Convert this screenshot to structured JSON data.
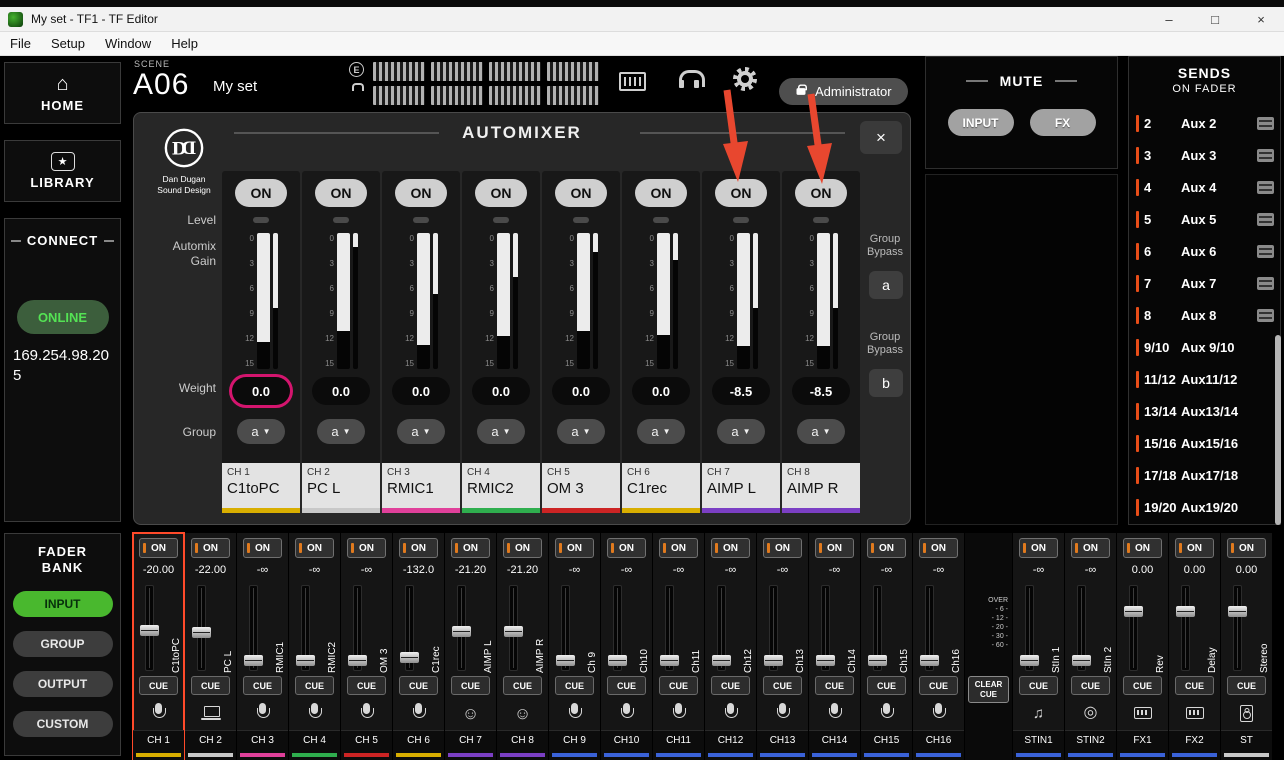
{
  "window": {
    "title": "My set - TF1 - TF Editor",
    "controls": {
      "minimize": "–",
      "maximize": "□",
      "close": "×"
    },
    "menu": [
      "File",
      "Setup",
      "Window",
      "Help"
    ]
  },
  "topbar": {
    "scene_label": "SCENE",
    "scene_id": "A06",
    "scene_name": "My set",
    "edit_badge": "E",
    "user": "Administrator"
  },
  "sidebar": {
    "home": "HOME",
    "home_glyph": "⌂",
    "library": "LIBRARY",
    "library_glyph": "★",
    "connect": "CONNECT",
    "online": "ONLINE",
    "ip": "169.254.98.205",
    "fader_bank": "FADER BANK",
    "banks": [
      {
        "label": "INPUT",
        "active": true
      },
      {
        "label": "GROUP"
      },
      {
        "label": "OUTPUT"
      },
      {
        "label": "CUSTOM"
      }
    ]
  },
  "mute": {
    "title": "MUTE",
    "input": "INPUT",
    "fx": "FX"
  },
  "sends": {
    "title": "SENDS",
    "subtitle": "ON FADER",
    "items": [
      {
        "num": "2",
        "label": "Aux 2",
        "has_icon": true
      },
      {
        "num": "3",
        "label": "Aux 3",
        "has_icon": true
      },
      {
        "num": "4",
        "label": "Aux 4",
        "has_icon": true
      },
      {
        "num": "5",
        "label": "Aux 5",
        "has_icon": true
      },
      {
        "num": "6",
        "label": "Aux 6",
        "has_icon": true
      },
      {
        "num": "7",
        "label": "Aux 7",
        "has_icon": true
      },
      {
        "num": "8",
        "label": "Aux 8",
        "has_icon": true
      },
      {
        "num": "9/10",
        "label": "Aux 9/10",
        "has_icon": false
      },
      {
        "num": "11/12",
        "label": "Aux11/12",
        "has_icon": false
      },
      {
        "num": "13/14",
        "label": "Aux13/14",
        "has_icon": false
      },
      {
        "num": "15/16",
        "label": "Aux15/16",
        "has_icon": false
      },
      {
        "num": "17/18",
        "label": "Aux17/18",
        "has_icon": false
      },
      {
        "num": "19/20",
        "label": "Aux19/20",
        "has_icon": false
      }
    ]
  },
  "automixer": {
    "title": "AUTOMIXER",
    "close": "×",
    "logo": {
      "line1": "Dan Dugan",
      "line2": "Sound Design"
    },
    "labels": {
      "level": "Level",
      "gain1": "Automix",
      "gain2": "Gain",
      "weight": "Weight",
      "group": "Group"
    },
    "on_label": "ON",
    "caret": "▼",
    "scale": [
      "0",
      "3",
      "6",
      "9",
      "12",
      "15"
    ],
    "bypass": {
      "label1": "Group",
      "label2": "Bypass",
      "a": "a",
      "b": "b"
    },
    "channels": [
      {
        "weight": "0.0",
        "group": "a",
        "ch": "CH 1",
        "name": "C1toPC",
        "color": "#d8ae00",
        "main": "80%",
        "side": "55%",
        "ring": "0 0 0 3px #d4156e"
      },
      {
        "weight": "0.0",
        "group": "a",
        "ch": "CH 2",
        "name": "PC L",
        "color": "#c8c8c8",
        "main": "72%",
        "side": "10%"
      },
      {
        "weight": "0.0",
        "group": "a",
        "ch": "CH 3",
        "name": "RMIC1",
        "color": "#e0409a",
        "main": "82%",
        "side": "45%"
      },
      {
        "weight": "0.0",
        "group": "a",
        "ch": "CH 4",
        "name": "RMIC2",
        "color": "#2fae4e",
        "main": "76%",
        "side": "32%"
      },
      {
        "weight": "0.0",
        "group": "a",
        "ch": "CH 5",
        "name": "OM 3",
        "color": "#cc2424",
        "main": "72%",
        "side": "14%"
      },
      {
        "weight": "0.0",
        "group": "a",
        "ch": "CH 6",
        "name": "C1rec",
        "color": "#d8ae00",
        "main": "75%",
        "side": "20%"
      },
      {
        "weight": "-8.5",
        "group": "a",
        "ch": "CH 7",
        "name": "AIMP L",
        "color": "#7b3fc4",
        "main": "83%",
        "side": "55%"
      },
      {
        "weight": "-8.5",
        "group": "a",
        "ch": "CH 8",
        "name": "AIMP R",
        "color": "#7b3fc4",
        "main": "83%",
        "side": "55%"
      }
    ]
  },
  "faders": {
    "on_label": "ON",
    "cue_label": "CUE",
    "bridge": {
      "labels": [
        "OVER",
        "- 6 -",
        "- 12 -",
        "- 20 -",
        "- 30 -",
        "- 60 -"
      ],
      "clear1": "CLEAR",
      "clear2": "CUE"
    },
    "strips": [
      {
        "value": "-20.00",
        "name": "C1toPC",
        "ch": "CH 1",
        "color": "#d8ae00",
        "icon": "mic",
        "fader": "52%",
        "outline": "2px solid #ff4a2a"
      },
      {
        "value": "-22.00",
        "name": "PC L",
        "ch": "CH 2",
        "color": "#c8c8c8",
        "icon": "laptop",
        "fader": "55%"
      },
      {
        "value": "-∞",
        "name": "RMIC1",
        "ch": "CH 3",
        "color": "#e0409a",
        "icon": "mic",
        "fader": "88%"
      },
      {
        "value": "-∞",
        "name": "RMIC2",
        "ch": "CH 4",
        "color": "#2fae4e",
        "icon": "mic",
        "fader": "88%"
      },
      {
        "value": "-∞",
        "name": "OM 3",
        "ch": "CH 5",
        "color": "#cc2424",
        "icon": "mic",
        "fader": "88%"
      },
      {
        "value": "-132.0",
        "name": "C1rec",
        "ch": "CH 6",
        "color": "#d8ae00",
        "icon": "mic",
        "fader": "85%"
      },
      {
        "value": "-21.20",
        "name": "AIMP L",
        "ch": "CH 7",
        "color": "#7b3fc4",
        "icon": "smiley",
        "fader": "53%"
      },
      {
        "value": "-21.20",
        "name": "AIMP R",
        "ch": "CH 8",
        "color": "#7b3fc4",
        "icon": "smiley",
        "fader": "53%"
      },
      {
        "value": "-∞",
        "name": "Ch 9",
        "ch": "CH 9",
        "color": "#3a62d8",
        "icon": "mic",
        "fader": "88%"
      },
      {
        "value": "-∞",
        "name": "Ch10",
        "ch": "CH10",
        "color": "#3a62d8",
        "icon": "mic",
        "fader": "88%"
      },
      {
        "value": "-∞",
        "name": "Ch11",
        "ch": "CH11",
        "color": "#3a62d8",
        "icon": "mic",
        "fader": "88%"
      },
      {
        "value": "-∞",
        "name": "Ch12",
        "ch": "CH12",
        "color": "#3a62d8",
        "icon": "mic",
        "fader": "88%"
      },
      {
        "value": "-∞",
        "name": "Ch13",
        "ch": "CH13",
        "color": "#3a62d8",
        "icon": "mic",
        "fader": "88%"
      },
      {
        "value": "-∞",
        "name": "Ch14",
        "ch": "CH14",
        "color": "#3a62d8",
        "icon": "mic",
        "fader": "88%"
      },
      {
        "value": "-∞",
        "name": "Ch15",
        "ch": "CH15",
        "color": "#3a62d8",
        "icon": "mic",
        "fader": "88%"
      },
      {
        "value": "-∞",
        "name": "Ch16",
        "ch": "CH16",
        "color": "#3a62d8",
        "icon": "mic",
        "fader": "88%"
      }
    ],
    "masters": [
      {
        "value": "-∞",
        "name": "StIn 1",
        "ch": "STIN1",
        "color": "#3a62d8",
        "icon": "music",
        "fader": "88%"
      },
      {
        "value": "-∞",
        "name": "StIn 2",
        "ch": "STIN2",
        "color": "#3a62d8",
        "icon": "disc",
        "fader": "88%"
      },
      {
        "value": "0.00",
        "name": "Rev",
        "ch": "FX1",
        "color": "#3a62d8",
        "icon": "keys",
        "fader": "30%"
      },
      {
        "value": "0.00",
        "name": "Delay",
        "ch": "FX2",
        "color": "#3a62d8",
        "icon": "keys",
        "fader": "30%"
      },
      {
        "value": "0.00",
        "name": "Stereo",
        "ch": "ST",
        "color": "#c8c8c8",
        "icon": "speaker",
        "fader": "30%"
      }
    ]
  },
  "annotations": {
    "arrow_color": "#e8472f",
    "arrows": [
      "CH 7 ON button",
      "CH 8 ON button"
    ]
  }
}
